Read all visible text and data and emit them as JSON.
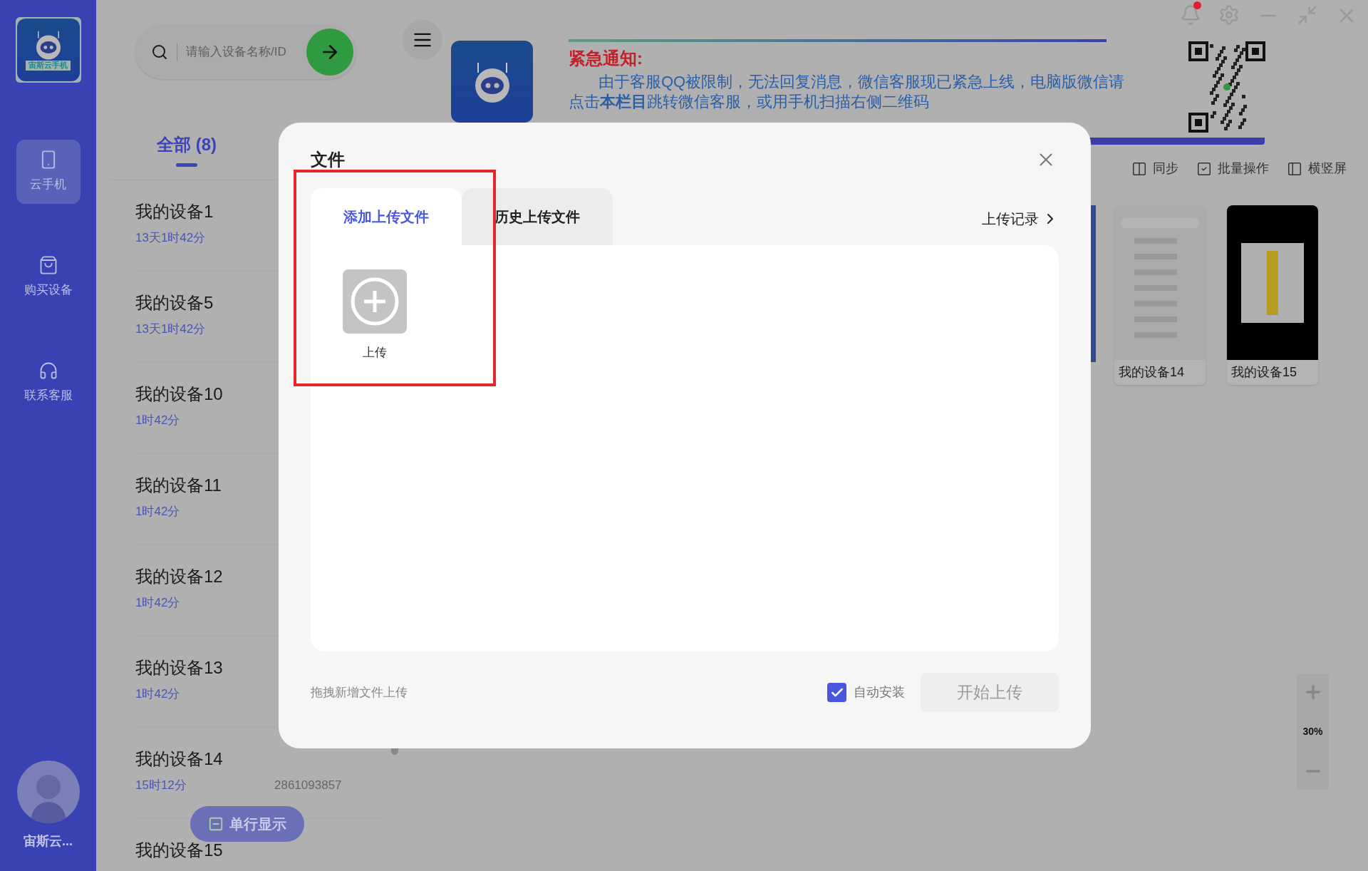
{
  "sidebar": {
    "logo_caption": "宙斯云手机",
    "items": [
      {
        "label": "云手机",
        "kind": "phone",
        "selected": true
      },
      {
        "label": "购买设备",
        "kind": "shop",
        "selected": false
      },
      {
        "label": "联系客服",
        "kind": "support",
        "selected": false
      }
    ],
    "user_name": "宙斯云..."
  },
  "search": {
    "placeholder": "请输入设备名称/ID"
  },
  "list_tabs": [
    {
      "label": "全部 (8)",
      "selected": true
    }
  ],
  "devices": [
    {
      "name": "我的设备1",
      "time": "13天1时42分"
    },
    {
      "name": "我的设备5",
      "time": "13天1时42分"
    },
    {
      "name": "我的设备10",
      "time": "1时42分"
    },
    {
      "name": "我的设备11",
      "time": "1时42分"
    },
    {
      "name": "我的设备12",
      "time": "1时42分"
    },
    {
      "name": "我的设备13",
      "time": "1时42分"
    },
    {
      "name": "我的设备14",
      "time": "15时12分",
      "id": "2861093857"
    },
    {
      "name": "我的设备15"
    }
  ],
  "view_toggle": "单行显示",
  "window": {
    "unread": true
  },
  "banner": {
    "title": "紧急通知:",
    "lines": [
      "由于客服QQ被限制，无法回复消息，微信客服现已紧急上线，电脑版微信请",
      "点击**本栏目**跳转微信客服，或用手机扫描右侧二维码"
    ]
  },
  "toolbar": [
    {
      "label": "同步",
      "kind": "sync"
    },
    {
      "label": "批量操作",
      "kind": "batch"
    },
    {
      "label": "横竖屏",
      "kind": "rotate"
    }
  ],
  "thumbnails": [
    {
      "name": "我的设备14",
      "kind": "light"
    },
    {
      "name": "我的设备15",
      "kind": "dark"
    }
  ],
  "zoom": "30%",
  "dialog": {
    "title": "文件",
    "tabs": [
      {
        "label": "添加上传文件",
        "selected": true
      },
      {
        "label": "历史上传文件",
        "selected": false
      }
    ],
    "record_link": "上传记录",
    "upload_tile": "上传",
    "hint": "拖拽新增文件上传",
    "auto_install": {
      "label": "自动安装",
      "checked": true
    },
    "start_button": {
      "label": "开始上传",
      "disabled": true
    }
  }
}
